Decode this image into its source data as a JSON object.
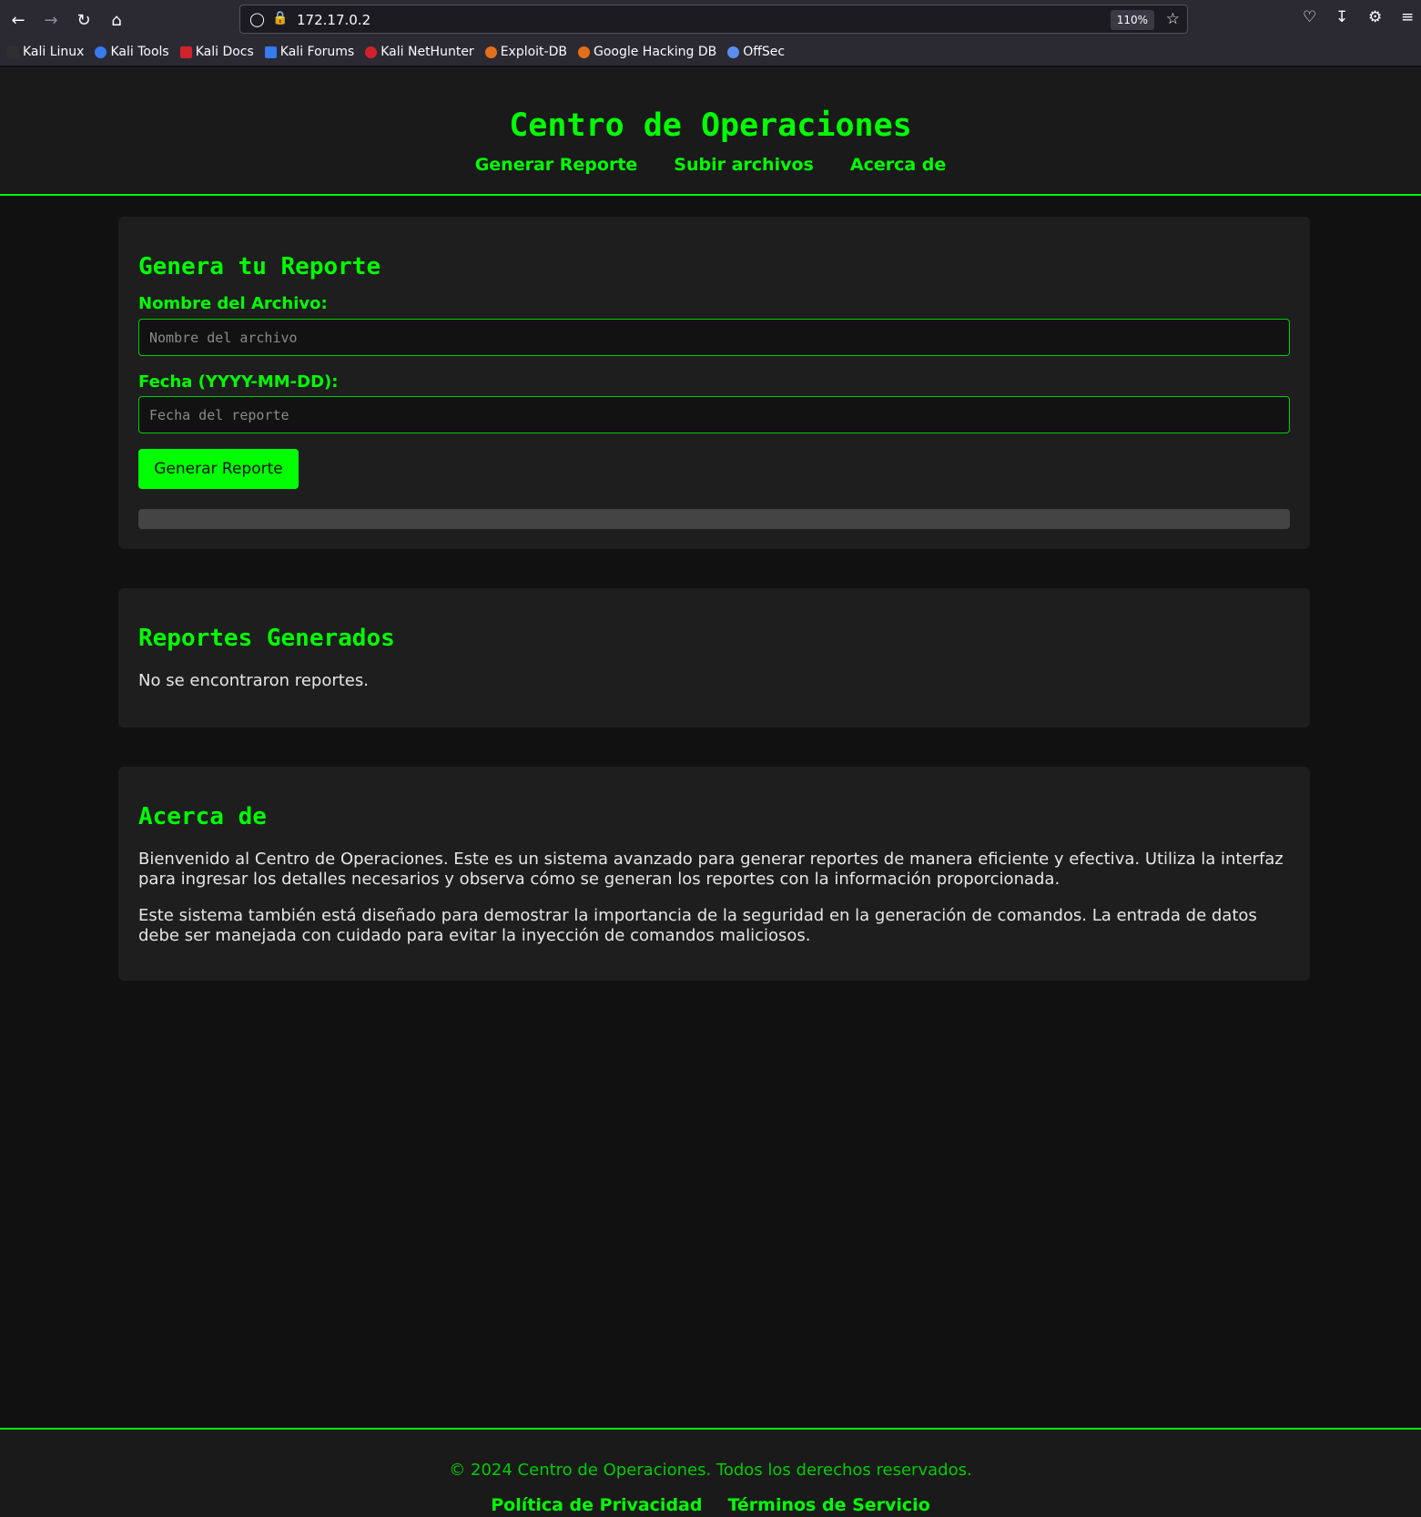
{
  "browser": {
    "url": "172.17.0.2",
    "zoom": "110%",
    "bookmarks": [
      {
        "label": "Kali Linux",
        "color": "#2f2f2f"
      },
      {
        "label": "Kali Tools",
        "color": "#367bf0"
      },
      {
        "label": "Kali Docs",
        "color": "#d3212c"
      },
      {
        "label": "Kali Forums",
        "color": "#367bf0"
      },
      {
        "label": "Kali NetHunter",
        "color": "#d3212c"
      },
      {
        "label": "Exploit-DB",
        "color": "#e2701a"
      },
      {
        "label": "Google Hacking DB",
        "color": "#e2701a"
      },
      {
        "label": "OffSec",
        "color": "#5b8def"
      }
    ]
  },
  "header": {
    "title": "Centro de Operaciones",
    "nav": [
      "Generar Reporte",
      "Subir archivos",
      "Acerca de"
    ]
  },
  "report_form": {
    "heading": "Genera tu Reporte",
    "filename_label": "Nombre del Archivo:",
    "filename_placeholder": "Nombre del archivo",
    "filename_value": "",
    "date_label": "Fecha (YYYY-MM-DD):",
    "date_placeholder": "Fecha del reporte",
    "date_value": "",
    "submit_label": "Generar Reporte",
    "progress_fraction": 0
  },
  "reports": {
    "heading": "Reportes Generados",
    "empty_text": "No se encontraron reportes."
  },
  "about": {
    "heading": "Acerca de",
    "paragraph1": "Bienvenido al Centro de Operaciones. Este es un sistema avanzado para generar reportes de manera eficiente y efectiva. Utiliza la interfaz para ingresar los detalles necesarios y observa cómo se generan los reportes con la información proporcionada.",
    "paragraph2": "Este sistema también está diseñado para demostrar la importancia de la seguridad en la generación de comandos. La entrada de datos debe ser manejada con cuidado para evitar la inyección de comandos maliciosos."
  },
  "footer": {
    "copyright": "© 2024 Centro de Operaciones. Todos los derechos reservados.",
    "links": [
      "Política de Privacidad",
      "Términos de Servicio"
    ]
  },
  "colors": {
    "accent": "#00ff00",
    "background": "#111111",
    "card": "#1e1e1e"
  }
}
